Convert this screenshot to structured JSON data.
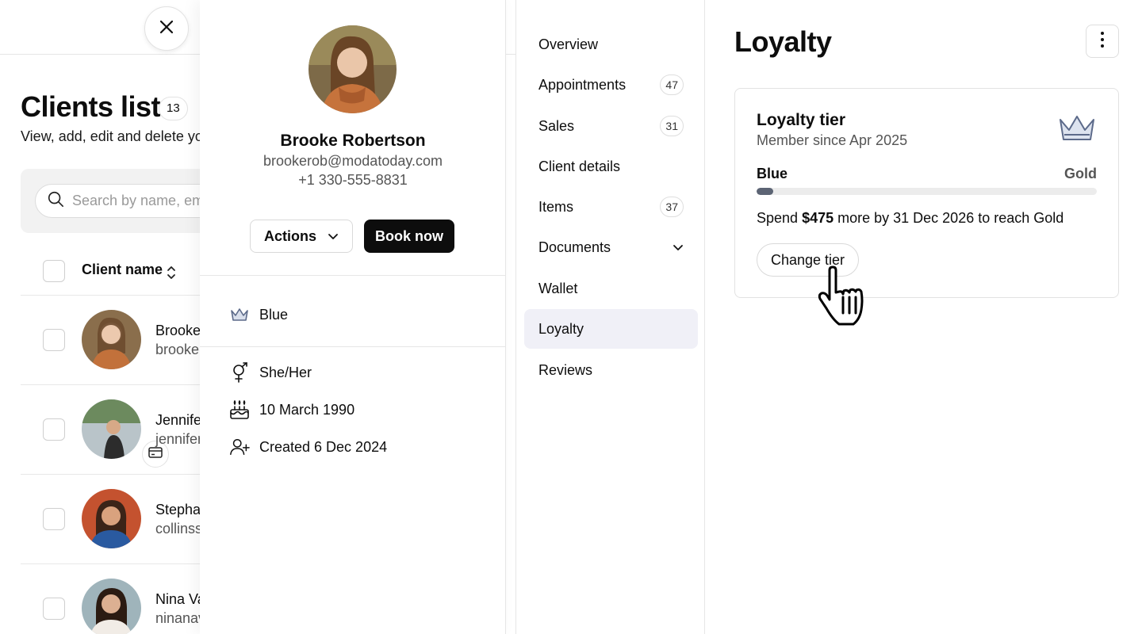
{
  "clients_list": {
    "title": "Clients list",
    "count": "13",
    "subtitle": "View, add, edit and delete you",
    "search_placeholder": "Search by name, ema",
    "column_header": "Client name",
    "rows": [
      {
        "name": "Brooke",
        "email": "brooke"
      },
      {
        "name": "Jennife",
        "email": "jennifer"
      },
      {
        "name": "Stepha",
        "email": "collinss"
      },
      {
        "name": "Nina Va",
        "email": "ninanav"
      }
    ]
  },
  "profile": {
    "name": "Brooke Robertson",
    "email": "brookerob@modatoday.com",
    "phone": "+1 330-555-8831",
    "actions_label": "Actions",
    "book_label": "Book now",
    "tier": "Blue",
    "pronouns": "She/Her",
    "birthday": "10 March 1990",
    "created": "Created 6 Dec 2024"
  },
  "nav": {
    "items": [
      {
        "label": "Overview",
        "count": ""
      },
      {
        "label": "Appointments",
        "count": "47"
      },
      {
        "label": "Sales",
        "count": "31"
      },
      {
        "label": "Client details",
        "count": ""
      },
      {
        "label": "Items",
        "count": "37"
      },
      {
        "label": "Documents",
        "count": ""
      },
      {
        "label": "Wallet",
        "count": ""
      },
      {
        "label": "Loyalty",
        "count": ""
      },
      {
        "label": "Reviews",
        "count": ""
      }
    ],
    "active": "Loyalty"
  },
  "loyalty": {
    "title": "Loyalty",
    "card_title": "Loyalty tier",
    "member_since": "Member since Apr 2025",
    "current_tier": "Blue",
    "next_tier": "Gold",
    "progress_percent": 5,
    "spend_prefix": "Spend ",
    "spend_amount": "$475",
    "spend_suffix": " more by 31 Dec 2026 to reach Gold",
    "change_label": "Change tier"
  },
  "colors": {
    "accent_dark": "#0d0d0d",
    "active_nav_bg": "#f0f0f7",
    "crown": "#5c6a8a",
    "progress_fill": "#5c6474"
  },
  "icons": [
    "close-icon",
    "search-icon",
    "sort-icon",
    "chevron-down-icon",
    "crown-icon",
    "gender-icon",
    "cake-icon",
    "user-add-icon",
    "kebab-icon",
    "card-icon",
    "hand-cursor-icon"
  ]
}
